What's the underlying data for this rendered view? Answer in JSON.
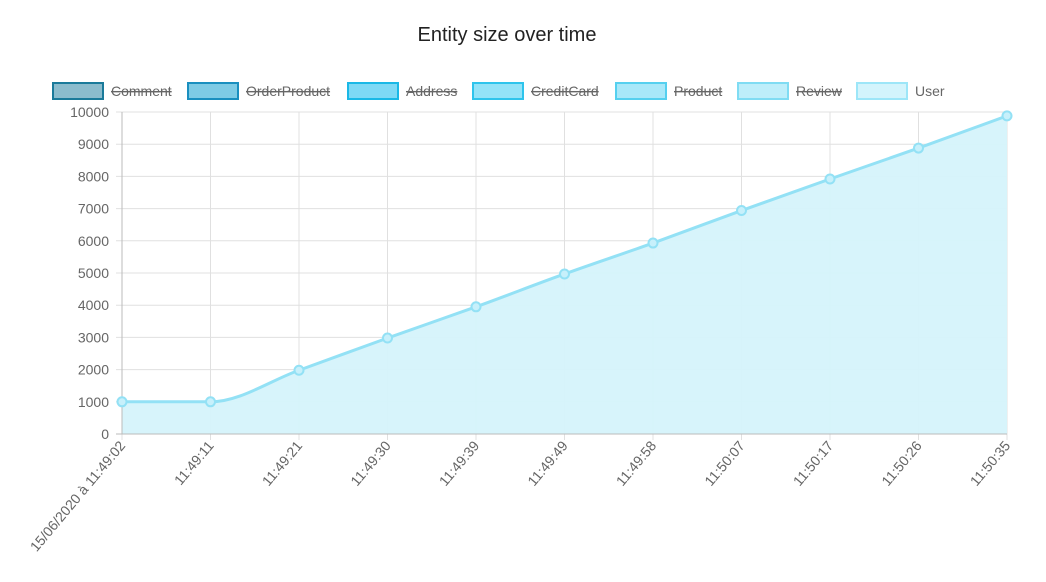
{
  "chart_data": {
    "type": "area",
    "title": "Entity size over time",
    "x": [
      "15/06/2020 à 11:49:02",
      "11:49:11",
      "11:49:21",
      "11:49:30",
      "11:49:39",
      "11:49:49",
      "11:49:58",
      "11:50:07",
      "11:50:17",
      "11:50:26",
      "11:50:35"
    ],
    "ylim": [
      0,
      10000
    ],
    "yticks": [
      0,
      1000,
      2000,
      3000,
      4000,
      5000,
      6000,
      7000,
      8000,
      9000,
      10000
    ],
    "grid": true,
    "legend_position": "top",
    "legend": [
      {
        "name": "Comment",
        "hidden": true,
        "fill": "#8bbccd",
        "stroke": "#1a7a9a"
      },
      {
        "name": "OrderProduct",
        "hidden": true,
        "fill": "#7ecbe5",
        "stroke": "#1a8fbf"
      },
      {
        "name": "Address",
        "hidden": true,
        "fill": "#7ed9f5",
        "stroke": "#1ab8e6"
      },
      {
        "name": "CreditCard",
        "hidden": true,
        "fill": "#93e3f8",
        "stroke": "#2ec4ec"
      },
      {
        "name": "Product",
        "hidden": true,
        "fill": "#a8e8f9",
        "stroke": "#55d0ef"
      },
      {
        "name": "Review",
        "hidden": true,
        "fill": "#bdeefa",
        "stroke": "#7fdcf3"
      },
      {
        "name": "User",
        "hidden": false,
        "fill": "#d3f4fc",
        "stroke": "#9de6f8"
      }
    ],
    "series": [
      {
        "name": "User",
        "values": [
          1000,
          1000,
          1980,
          2980,
          3950,
          4970,
          5930,
          6940,
          7920,
          8880,
          9880
        ],
        "color": "#93e1f5",
        "fill": "#d5f3fb"
      }
    ]
  }
}
